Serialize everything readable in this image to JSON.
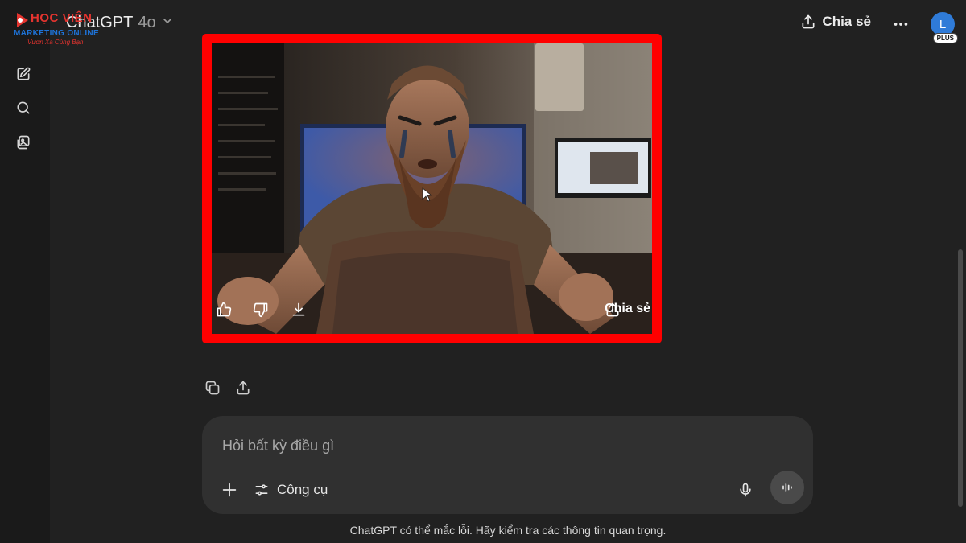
{
  "header": {
    "model_name": "ChatGPT",
    "model_version": "4o",
    "share_label": "Chia sẻ",
    "avatar_initial": "L",
    "plan_badge": "PLUS"
  },
  "watermark": {
    "line1": "HỌC VIỆN",
    "line2": "MARKETING ONLINE",
    "line3": "Vươn Xa Cùng Bạn"
  },
  "sidebar": {
    "items": [
      {
        "icon": "new-chat-icon"
      },
      {
        "icon": "search-icon"
      },
      {
        "icon": "library-icon"
      }
    ]
  },
  "image_result": {
    "share_label": "Chia sẻ",
    "actions": [
      "thumbs-up-icon",
      "thumbs-down-icon",
      "download-icon"
    ]
  },
  "message_actions": [
    "copy-icon",
    "share-icon"
  ],
  "composer": {
    "placeholder": "Hỏi bất kỳ điều gì",
    "tools_label": "Công cụ"
  },
  "footer": {
    "disclaimer": "ChatGPT có thể mắc lỗi. Hãy kiểm tra các thông tin quan trọng."
  },
  "colors": {
    "background": "#212121",
    "highlight_border": "#ff0000",
    "avatar": "#2f7bd8"
  }
}
